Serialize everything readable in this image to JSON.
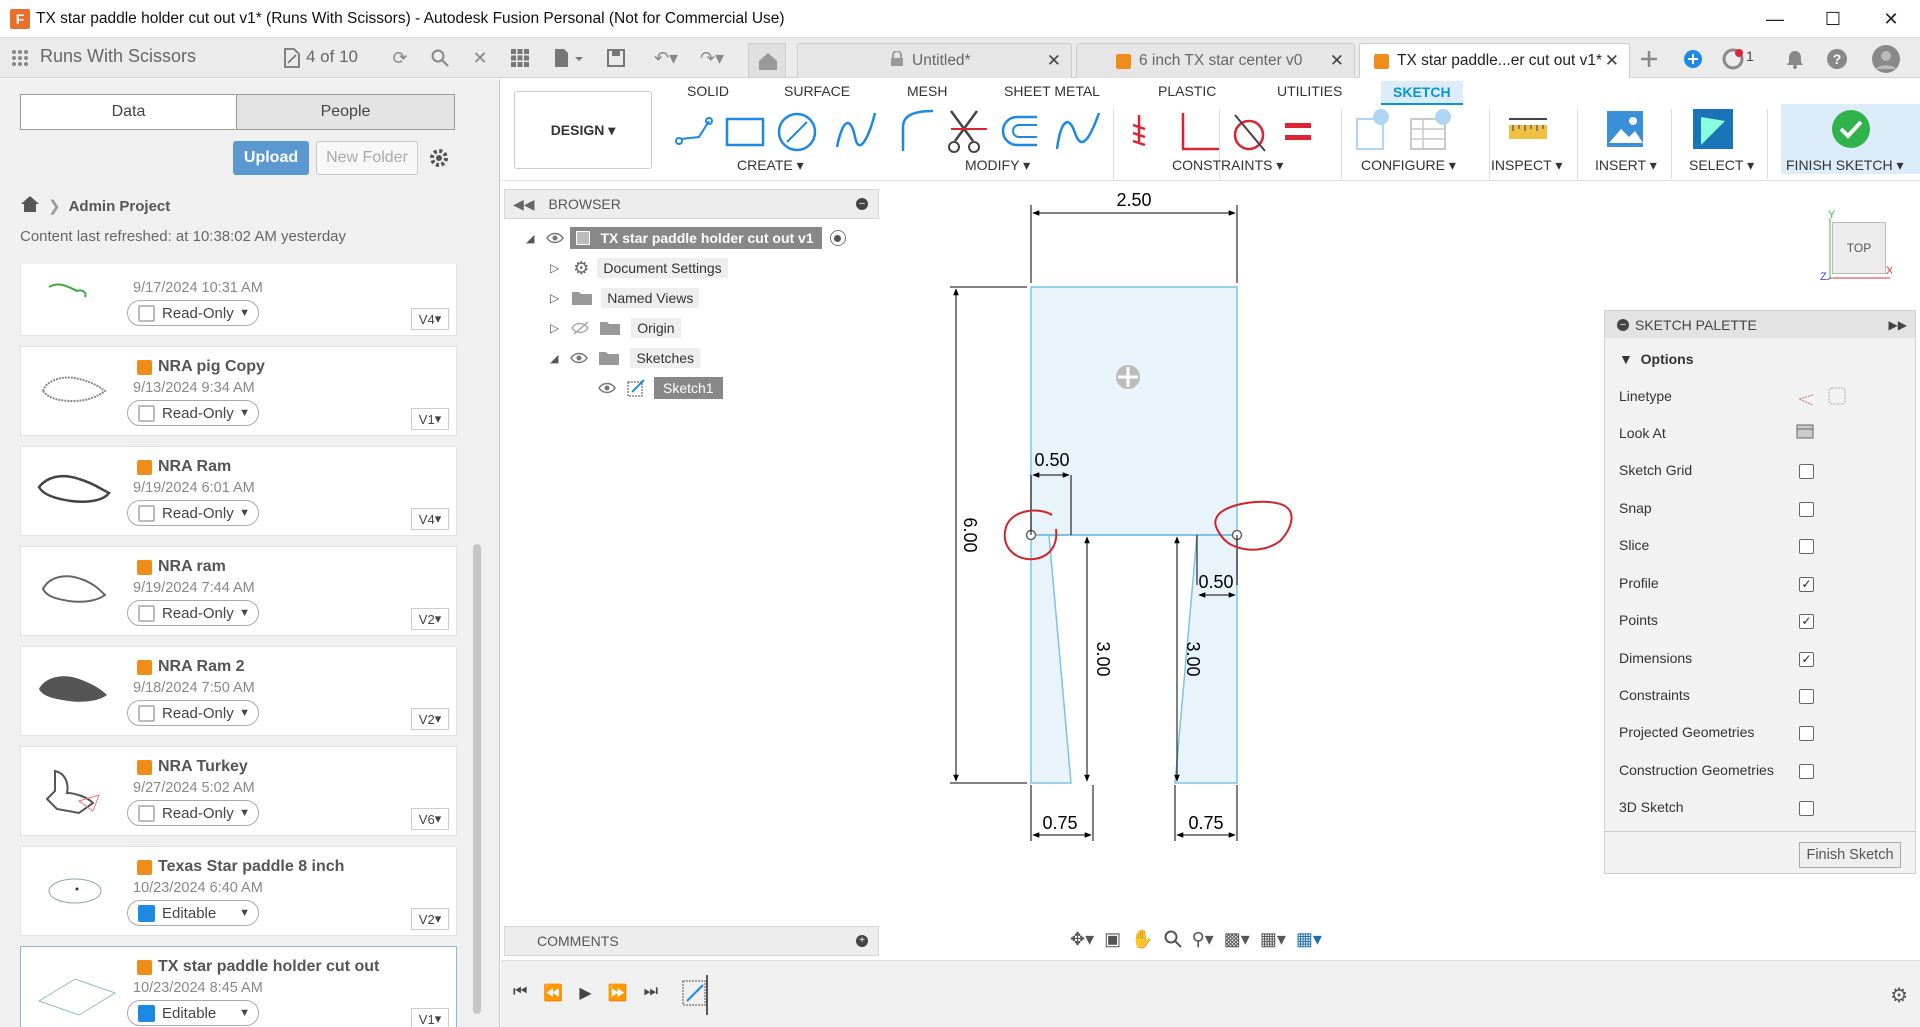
{
  "window": {
    "title": "TX star paddle holder cut out v1* (Runs With Scissors) - Autodesk Fusion Personal (Not for Commercial Use)",
    "logo": "F"
  },
  "appbar": {
    "team": "Runs With Scissors",
    "doc_count": "4 of 10",
    "notif_count": "1"
  },
  "tabs": [
    {
      "label": "Untitled*",
      "icon": "lock-icon",
      "active": false
    },
    {
      "label": "6 inch TX star center v0",
      "icon": "cube-icon",
      "active": false
    },
    {
      "label": "TX star paddle...er cut out v1*",
      "icon": "cube-icon",
      "active": true
    }
  ],
  "data_panel": {
    "seg_data": "Data",
    "seg_people": "People",
    "upload": "Upload",
    "new_folder": "New Folder",
    "project": "Admin Project",
    "refreshed": "Content last refreshed: at 10:38:02 AM yesterday",
    "files": [
      {
        "name": "",
        "date": "9/17/2024 10:31 AM",
        "perm": "Read-Only",
        "ver": "V4"
      },
      {
        "name": "NRA pig Copy",
        "date": "9/13/2024 9:34 AM",
        "perm": "Read-Only",
        "ver": "V1"
      },
      {
        "name": "NRA Ram",
        "date": "9/19/2024 6:01 AM",
        "perm": "Read-Only",
        "ver": "V4"
      },
      {
        "name": "NRA ram",
        "date": "9/19/2024 7:44 AM",
        "perm": "Read-Only",
        "ver": "V2"
      },
      {
        "name": "NRA Ram 2",
        "date": "9/18/2024 7:50 AM",
        "perm": "Read-Only",
        "ver": "V2"
      },
      {
        "name": "NRA Turkey",
        "date": "9/27/2024 5:02 AM",
        "perm": "Read-Only",
        "ver": "V6"
      },
      {
        "name": "Texas Star paddle 8 inch",
        "date": "10/23/2024 6:40 AM",
        "perm": "Editable",
        "ver": "V2"
      },
      {
        "name": "TX star paddle holder cut out",
        "date": "10/23/2024 8:45 AM",
        "perm": "Editable",
        "ver": "V1"
      }
    ]
  },
  "toolbar": {
    "workspace": "DESIGN",
    "tabs": [
      "SOLID",
      "SURFACE",
      "MESH",
      "SHEET METAL",
      "PLASTIC",
      "UTILITIES",
      "SKETCH"
    ],
    "groups": [
      "CREATE",
      "MODIFY",
      "CONSTRAINTS",
      "CONFIGURE",
      "INSPECT",
      "INSERT",
      "SELECT",
      "FINISH SKETCH"
    ]
  },
  "browser": {
    "title": "BROWSER",
    "root": "TX star paddle holder cut out v1",
    "nodes": [
      "Document Settings",
      "Named Views",
      "Origin",
      "Sketches",
      "Sketch1"
    ],
    "comments": "COMMENTS"
  },
  "sketch": {
    "dims": {
      "width": "2.50",
      "height": "6.00",
      "offset_left": "0.50",
      "offset_right": "0.50",
      "leg_left": "3.00",
      "leg_right": "3.00",
      "foot_left": "0.75",
      "foot_right": "0.75"
    },
    "viewcube": "TOP"
  },
  "palette": {
    "title": "SKETCH PALETTE",
    "section": "Options",
    "options": [
      {
        "label": "Linetype",
        "type": "icon"
      },
      {
        "label": "Look At",
        "type": "icon"
      },
      {
        "label": "Sketch Grid",
        "checked": false
      },
      {
        "label": "Snap",
        "checked": false
      },
      {
        "label": "Slice",
        "checked": false
      },
      {
        "label": "Profile",
        "checked": true
      },
      {
        "label": "Points",
        "checked": true
      },
      {
        "label": "Dimensions",
        "checked": true
      },
      {
        "label": "Constraints",
        "checked": false
      },
      {
        "label": "Projected Geometries",
        "checked": false
      },
      {
        "label": "Construction Geometries",
        "checked": false
      },
      {
        "label": "3D Sketch",
        "checked": false
      }
    ],
    "finish": "Finish Sketch"
  },
  "colors": {
    "accent": "#0696d7",
    "upload": "#5b98cf",
    "sketch_fill": "#e8f3fa",
    "sketch_line": "#7ec3e3",
    "markup": "#d0242b",
    "finish_green": "#2fb34a"
  }
}
